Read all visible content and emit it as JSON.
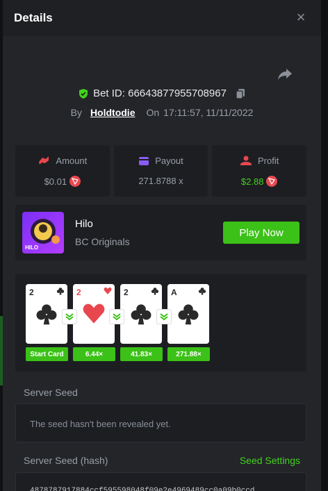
{
  "header": {
    "title": "Details",
    "close": "×"
  },
  "bet": {
    "id_label": "Bet ID: 66643877955708967"
  },
  "meta": {
    "by_label": "By",
    "user": "Holdtodie",
    "on_label": "On",
    "timestamp": "17:11:57, 11/11/2022"
  },
  "stats": [
    {
      "label": "Amount",
      "value": "$0.01",
      "icon": "amount-icon",
      "color": "#e8474f"
    },
    {
      "label": "Payout",
      "value": "271.8788 x",
      "icon": "payout-icon",
      "color": "#8a5cf5"
    },
    {
      "label": "Profit",
      "value": "$2.88",
      "icon": "profit-icon",
      "color": "#e8474f"
    }
  ],
  "game": {
    "name": "Hilo",
    "provider": "BC Originals",
    "thumb_label": "HILO",
    "play_label": "Play Now"
  },
  "cards": [
    {
      "rank": "2",
      "suit": "clubs"
    },
    {
      "rank": "2",
      "suit": "hearts"
    },
    {
      "rank": "2",
      "suit": "clubs"
    },
    {
      "rank": "A",
      "suit": "clubs"
    }
  ],
  "multipliers": [
    "Start Card",
    "6.44×",
    "41.83×",
    "271.88×"
  ],
  "server_seed": {
    "label": "Server Seed",
    "message": "The seed hasn't been revealed yet."
  },
  "server_seed_hash": {
    "label": "Server Seed (hash)",
    "settings_label": "Seed Settings",
    "value": "4878787917884ccf595598048f09e2e4969489cc0a09b0ccd"
  },
  "colors": {
    "accent_green": "#3bc117",
    "profit_green": "#43d31e",
    "trx_red": "#e8474f"
  }
}
